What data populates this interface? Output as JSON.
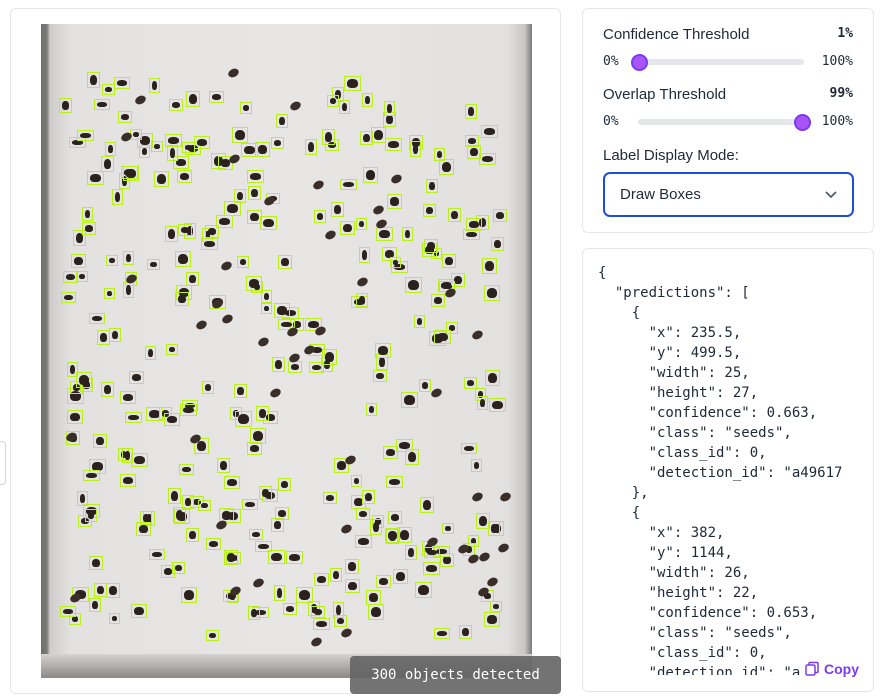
{
  "image_panel": {
    "count_label": "300 objects detected"
  },
  "controls": {
    "confidence": {
      "label": "Confidence Threshold",
      "value_text": "1%",
      "value": 0.01,
      "min_label": "0%",
      "max_label": "100%"
    },
    "overlap": {
      "label": "Overlap Threshold",
      "value_text": "99%",
      "value": 0.99,
      "min_label": "0%",
      "max_label": "100%"
    },
    "label_mode": {
      "label": "Label Display Mode:",
      "selected": "Draw Boxes"
    }
  },
  "json_output": {
    "text": "{\n  \"predictions\": [\n    {\n      \"x\": 235.5,\n      \"y\": 499.5,\n      \"width\": 25,\n      \"height\": 27,\n      \"confidence\": 0.663,\n      \"class\": \"seeds\",\n      \"class_id\": 0,\n      \"detection_id\": \"a49617\n    },\n    {\n      \"x\": 382,\n      \"y\": 1144,\n      \"width\": 26,\n      \"height\": 22,\n      \"confidence\": 0.653,\n      \"class\": \"seeds\",\n      \"class_id\": 0,\n      \"detection_id\": \"a",
    "copy_label": "Copy"
  },
  "colors": {
    "box": "#b9f01a",
    "accent": "#7c3aed",
    "select_border": "#1d4ed8"
  }
}
